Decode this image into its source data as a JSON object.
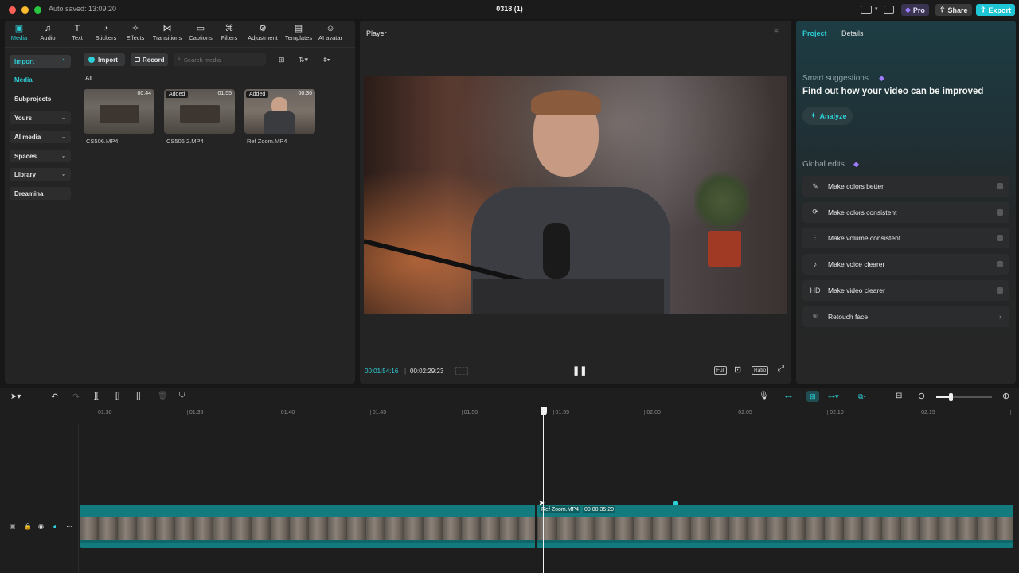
{
  "window": {
    "autosave": "Auto saved: 13:09:20",
    "title": "0318 (1)"
  },
  "topbar": {
    "pro": "Pro",
    "share": "Share",
    "export": "Export"
  },
  "media_tabs": [
    {
      "label": "Media",
      "icon": "media-icon"
    },
    {
      "label": "Audio",
      "icon": "audio-icon"
    },
    {
      "label": "Text",
      "icon": "text-icon"
    },
    {
      "label": "Stickers",
      "icon": "stickers-icon"
    },
    {
      "label": "Effects",
      "icon": "effects-icon"
    },
    {
      "label": "Transitions",
      "icon": "transitions-icon"
    },
    {
      "label": "Captions",
      "icon": "captions-icon"
    },
    {
      "label": "Filters",
      "icon": "filters-icon"
    },
    {
      "label": "Adjustment",
      "icon": "adjustment-icon"
    },
    {
      "label": "Templates",
      "icon": "templates-icon"
    },
    {
      "label": "AI avatar",
      "icon": "ai-avatar-icon"
    }
  ],
  "sidebar": {
    "items": [
      {
        "label": "Import"
      },
      {
        "label": "Media"
      },
      {
        "label": "Subprojects"
      },
      {
        "label": "Yours"
      },
      {
        "label": "AI media"
      },
      {
        "label": "Spaces"
      },
      {
        "label": "Library"
      },
      {
        "label": "Dreamina"
      }
    ]
  },
  "media_toolbar": {
    "import": "Import",
    "record": "Record",
    "search_placeholder": "Search media",
    "filter": "All"
  },
  "media_items": [
    {
      "name": "CS506.MP4",
      "duration": "00:44",
      "badge": ""
    },
    {
      "name": "CS506 2.MP4",
      "duration": "01:55",
      "badge": "Added"
    },
    {
      "name": "Ref Zoom.MP4",
      "duration": "00:36",
      "badge": "Added"
    }
  ],
  "player": {
    "title": "Player",
    "current_time": "00:01:54:16",
    "total_time": "00:02:29:23",
    "btn_full": "Full",
    "btn_ratio": "Ratio"
  },
  "right_panel": {
    "tab_project": "Project",
    "tab_details": "Details",
    "smart_title": "Smart suggestions",
    "smart_text": "Find out how your video can be improved",
    "analyze": "Analyze",
    "global_title": "Global edits",
    "global_items": [
      {
        "label": "Make colors better",
        "icon": "magic-wand-icon"
      },
      {
        "label": "Make colors consistent",
        "icon": "color-match-icon"
      },
      {
        "label": "Make volume consistent",
        "icon": "volume-sliders-icon"
      },
      {
        "label": "Make voice clearer",
        "icon": "voice-wave-icon"
      },
      {
        "label": "Make video clearer",
        "icon": "hd-icon",
        "glyph": "HD"
      },
      {
        "label": "Retouch face",
        "icon": "face-retouch-icon"
      }
    ]
  },
  "timeline": {
    "ruler": [
      "01:30",
      "01:35",
      "01:40",
      "01:45",
      "01:50",
      "01:55",
      "02:00",
      "02:05",
      "02:10",
      "02:15"
    ],
    "clip_name": "Ref Zoom.MP4",
    "clip_duration": "00:00:35:20"
  },
  "colors": {
    "accent": "#2ed0d8",
    "export": "#1ec5d4",
    "track": "#137b7d"
  }
}
